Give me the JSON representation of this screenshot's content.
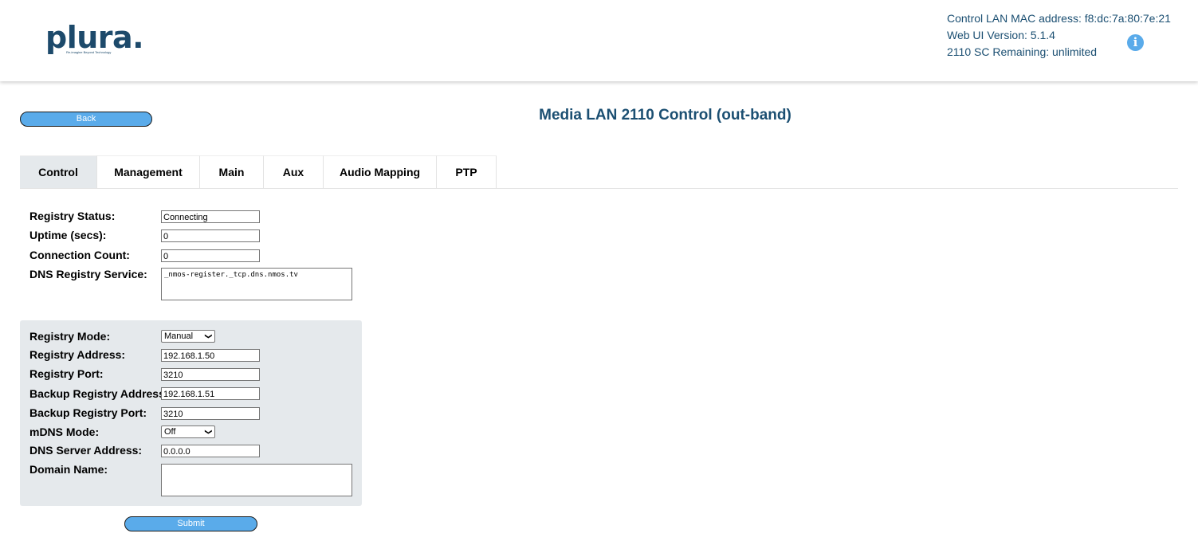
{
  "header": {
    "logo_text": "plura",
    "logo_tagline": "Re-imagine Beyond Technology",
    "mac_line": "Control LAN MAC address: f8:dc:7a:80:7e:21",
    "version_line": "Web UI Version: 5.1.4",
    "remaining_line": "2110 SC Remaining: unlimited",
    "info_icon": "i"
  },
  "back_label": "Back",
  "page_title": "Media LAN 2110 Control (out-band)",
  "tabs": [
    {
      "label": "Control",
      "active": true
    },
    {
      "label": "Management"
    },
    {
      "label": "Main"
    },
    {
      "label": "Aux"
    },
    {
      "label": "Audio Mapping"
    },
    {
      "label": "PTP"
    }
  ],
  "status": {
    "registry_status_label": "Registry Status:",
    "registry_status_value": "Connecting",
    "uptime_label": "Uptime (secs):",
    "uptime_value": "0",
    "connection_count_label": "Connection Count:",
    "connection_count_value": "0",
    "dns_service_label": "DNS Registry Service:",
    "dns_service_value": "_nmos-register._tcp.dns.nmos.tv"
  },
  "config": {
    "registry_mode_label": "Registry Mode:",
    "registry_mode_value": "Manual",
    "registry_address_label": "Registry Address:",
    "registry_address_value": "192.168.1.50",
    "registry_port_label": "Registry Port:",
    "registry_port_value": "3210",
    "backup_address_label": "Backup Registry Address:",
    "backup_address_value": "192.168.1.51",
    "backup_port_label": "Backup Registry Port:",
    "backup_port_value": "3210",
    "mdns_mode_label": "mDNS Mode:",
    "mdns_mode_value": "Off",
    "dns_server_label": "DNS Server Address:",
    "dns_server_value": "0.0.0.0",
    "domain_name_label": "Domain Name:",
    "domain_name_value": ""
  },
  "submit_label": "Submit",
  "colors": {
    "accent": "#5aabea",
    "title": "#1b4f72",
    "panel": "#e5e9ec",
    "logo": "#1d4a6b"
  }
}
